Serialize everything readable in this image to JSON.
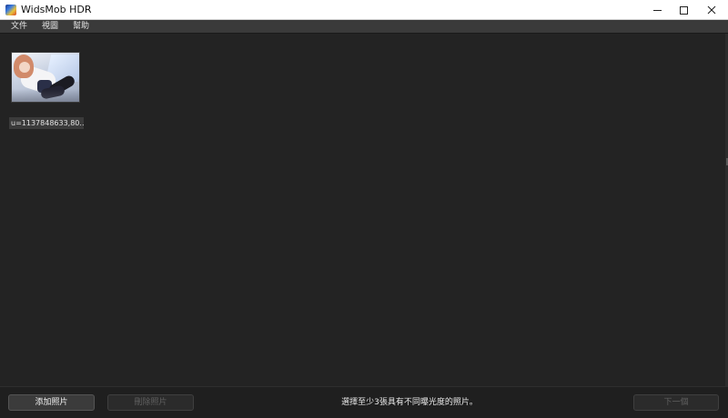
{
  "window": {
    "title": "WidsMob HDR"
  },
  "menu": {
    "items": [
      {
        "label": "文件"
      },
      {
        "label": "視圖"
      },
      {
        "label": "幫助"
      }
    ]
  },
  "photos": [
    {
      "filename": "u=1137848633,80..."
    }
  ],
  "footer": {
    "add_label": "添加照片",
    "delete_label": "刪除照片",
    "hint": "選擇至少3張具有不同曝光度的照片。",
    "next_label": "下一個"
  },
  "colors": {
    "background": "#232323",
    "menubar": "#3a3a3a",
    "titlebar": "#ffffff",
    "button": "#3b3b3b",
    "button_disabled_text": "#5f5f5f"
  }
}
